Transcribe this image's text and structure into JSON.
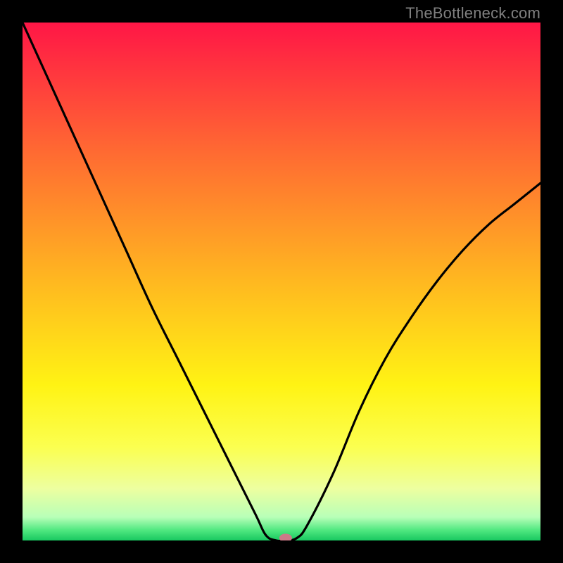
{
  "attribution": "TheBottleneck.com",
  "chart_data": {
    "type": "line",
    "title": "",
    "xlabel": "",
    "ylabel": "",
    "xlim": [
      0,
      100
    ],
    "ylim": [
      0,
      100
    ],
    "x": [
      0,
      5,
      10,
      15,
      20,
      25,
      30,
      35,
      40,
      45,
      47,
      49,
      51,
      53,
      55,
      60,
      65,
      70,
      75,
      80,
      85,
      90,
      95,
      100
    ],
    "values": [
      100,
      89,
      78,
      67,
      56,
      45,
      35,
      25,
      15,
      5,
      1,
      0,
      0,
      0.5,
      3,
      13,
      25,
      35,
      43,
      50,
      56,
      61,
      65,
      69
    ],
    "background_gradient": {
      "stops": [
        {
          "pos": 0.0,
          "color": "#ff1646"
        },
        {
          "pos": 0.25,
          "color": "#ff6a32"
        },
        {
          "pos": 0.5,
          "color": "#ffb820"
        },
        {
          "pos": 0.7,
          "color": "#fff314"
        },
        {
          "pos": 0.82,
          "color": "#fbff50"
        },
        {
          "pos": 0.9,
          "color": "#edffa0"
        },
        {
          "pos": 0.955,
          "color": "#b8ffb8"
        },
        {
          "pos": 0.98,
          "color": "#50e880"
        },
        {
          "pos": 1.0,
          "color": "#18c860"
        }
      ]
    },
    "marker": {
      "x": 50.8,
      "y": 0.5,
      "color": "#cc7a88",
      "rx": 9,
      "ry": 6
    }
  }
}
